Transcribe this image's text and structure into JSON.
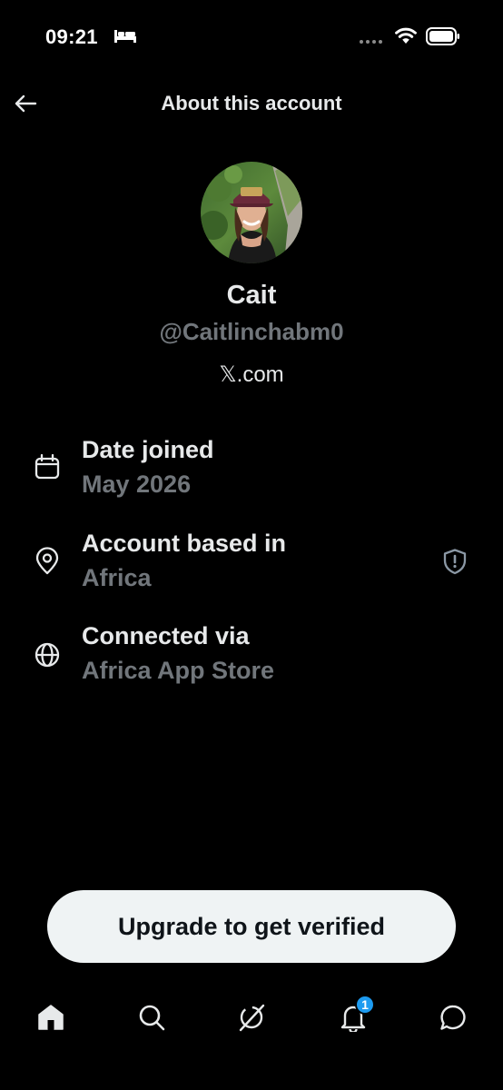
{
  "status_bar": {
    "time": "09:21",
    "sleep_icon": "bed-icon",
    "signal_icon": "signal-dots-icon",
    "wifi_icon": "wifi-icon",
    "battery_icon": "battery-icon"
  },
  "header": {
    "back_icon": "arrow-left-icon",
    "title": "About this account"
  },
  "profile": {
    "name": "Cait",
    "handle": "@Caitlinchabm0",
    "site": "𝕏.com"
  },
  "details": [
    {
      "icon": "calendar-icon",
      "label": "Date joined",
      "value": "May 2026"
    },
    {
      "icon": "location-pin-icon",
      "label": "Account based in",
      "value": "Africa",
      "action_icon": "shield-alert-icon"
    },
    {
      "icon": "globe-icon",
      "label": "Connected via",
      "value": "Africa App Store"
    }
  ],
  "cta": {
    "label": "Upgrade to get verified"
  },
  "tab_bar": {
    "tabs": [
      {
        "name": "home",
        "icon": "home-icon"
      },
      {
        "name": "search",
        "icon": "search-icon"
      },
      {
        "name": "grok",
        "icon": "grok-icon"
      },
      {
        "name": "notifications",
        "icon": "bell-icon",
        "badge": "1"
      },
      {
        "name": "messages",
        "icon": "message-icon"
      }
    ]
  },
  "colors": {
    "background": "#000000",
    "primary_text": "#e7e9ea",
    "secondary_text": "#71767b",
    "button_bg": "#eff3f4",
    "badge": "#1d9bf0"
  }
}
